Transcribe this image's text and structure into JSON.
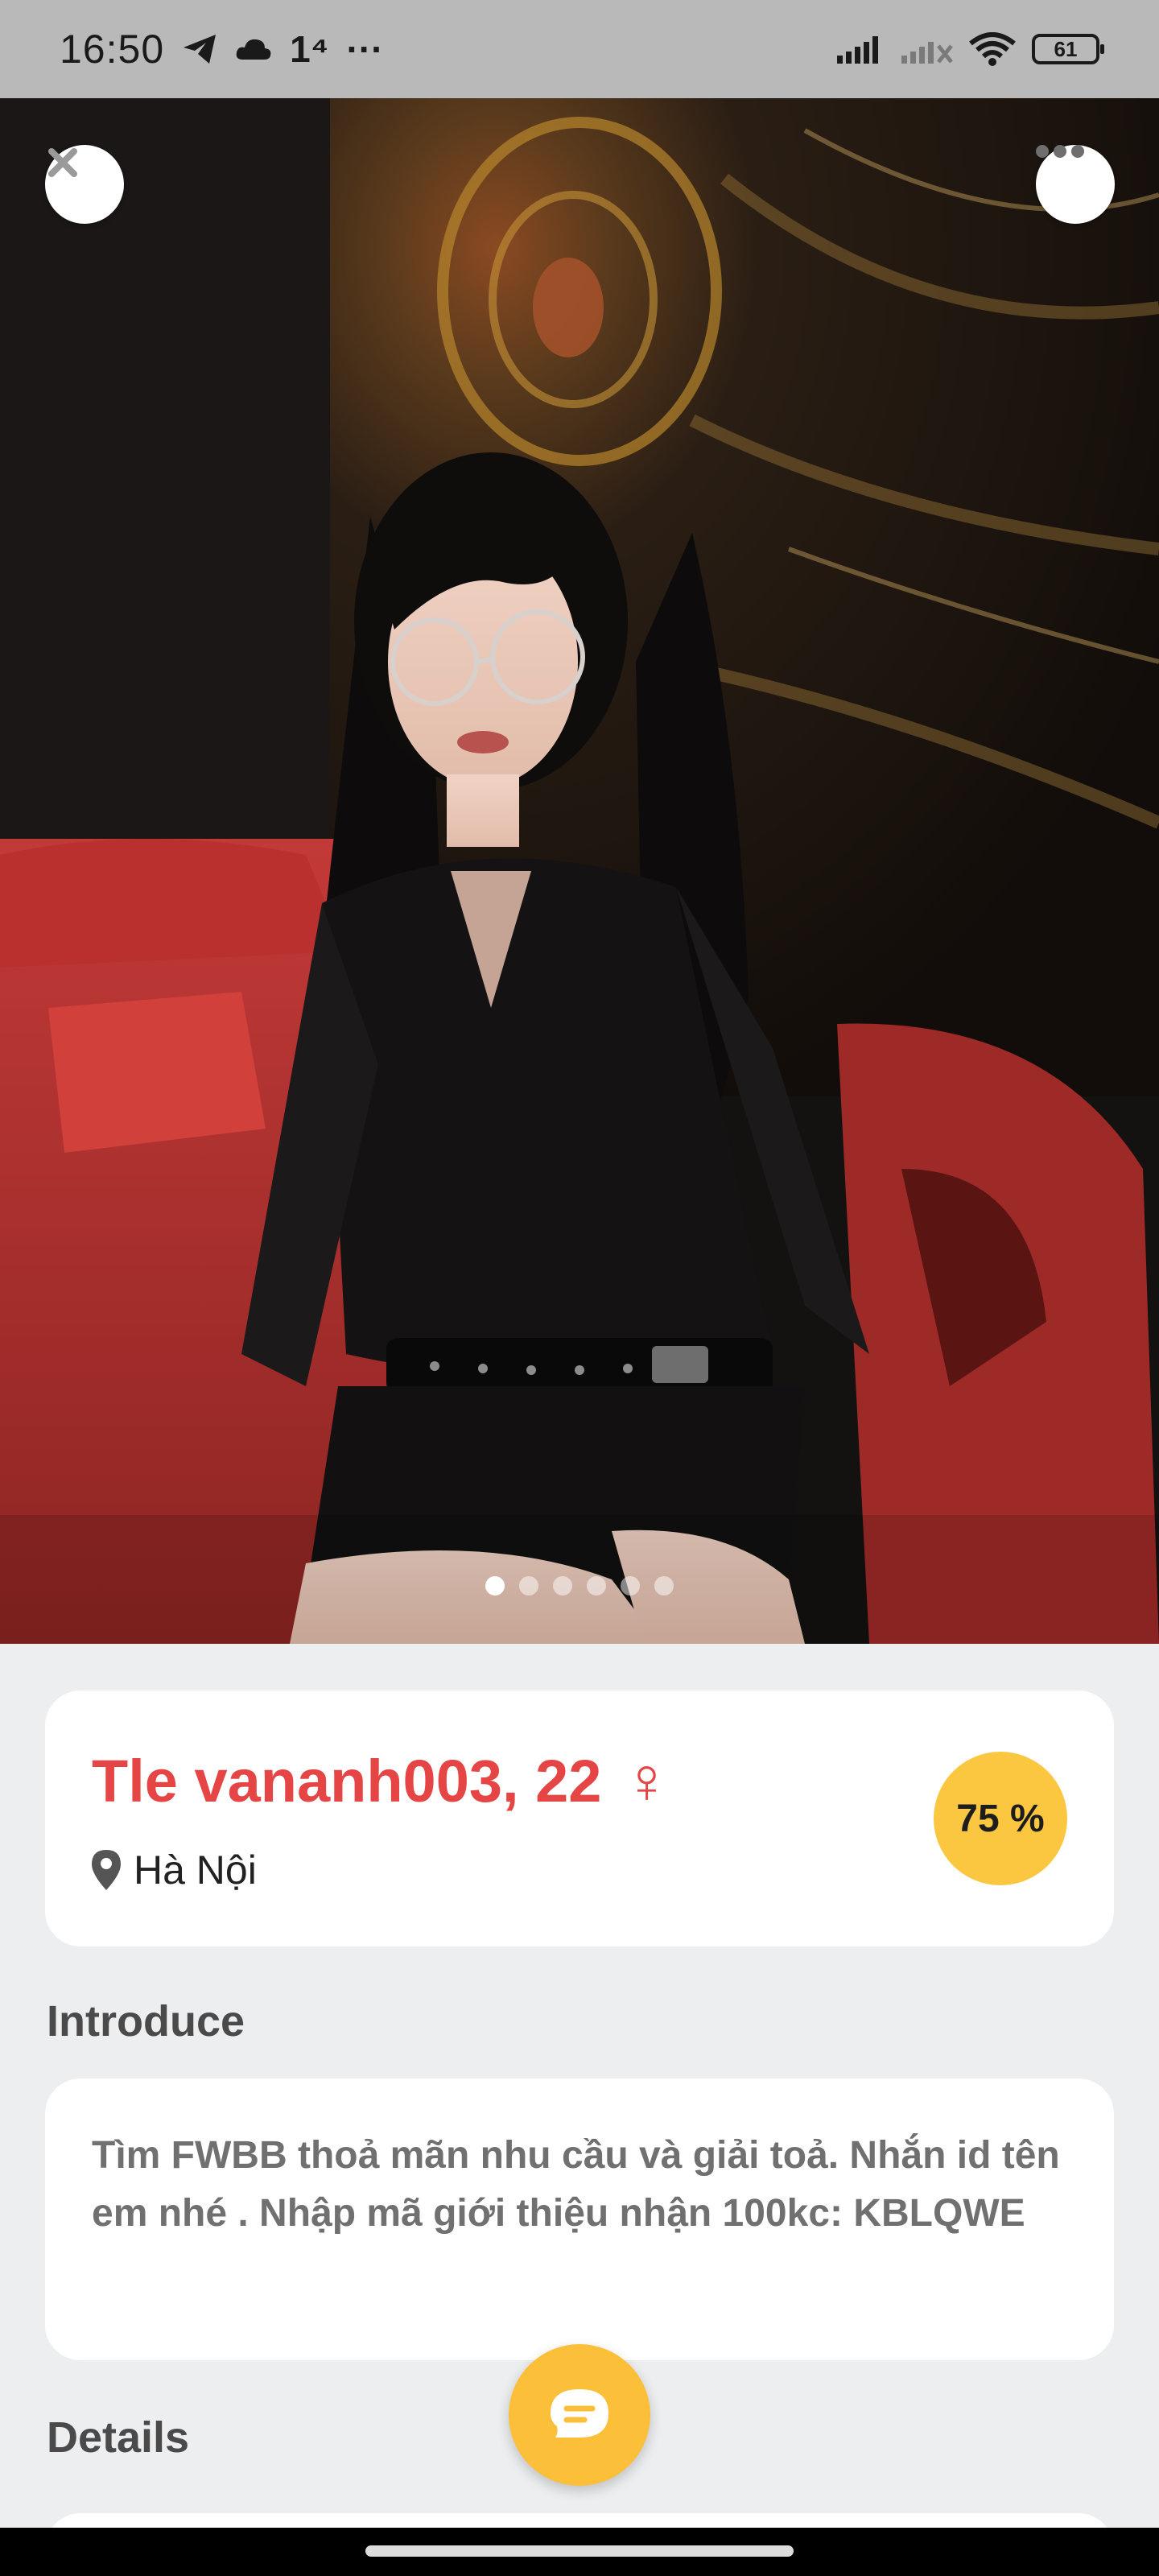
{
  "status_bar": {
    "time": "16:50",
    "extra": "1⁴",
    "more": "···",
    "battery": "61",
    "icons": [
      "telegram-icon",
      "cloud-icon",
      "signal-icon",
      "signal-off-icon",
      "wifi-icon",
      "battery-icon"
    ]
  },
  "photo": {
    "page_count": 6,
    "active_page": 1
  },
  "profile": {
    "name": "Tle vananh003, 22",
    "gender_symbol": "♀",
    "location": "Hà Nội",
    "match": "75 %"
  },
  "introduce": {
    "title": "Introduce",
    "text": "Tìm FWBB thoả mãn nhu cầu và giải toả. Nhắn id tên em nhé . Nhập mã giới thiệu nhận 100kc: KBLQWE"
  },
  "details": {
    "title": "Details"
  },
  "colors": {
    "name": "#e54545",
    "accent": "#fbc740",
    "background": "#eceef0"
  }
}
